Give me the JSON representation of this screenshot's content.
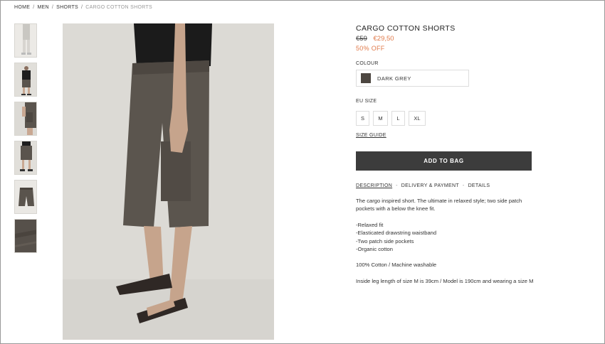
{
  "breadcrumb": [
    "HOME",
    "MEN",
    "SHORTS",
    "CARGO COTTON SHORTS"
  ],
  "breadcrumb_separator": "/",
  "product": {
    "title": "CARGO COTTON SHORTS",
    "old_price": "€59",
    "new_price": "€29,50",
    "discount": "50% OFF",
    "colour_label": "COLOUR",
    "colour_name": "DARK GREY",
    "colour_hex": "#4c4640",
    "size_label": "EU SIZE",
    "sizes": [
      "S",
      "M",
      "L",
      "XL"
    ],
    "size_guide": "SIZE GUIDE",
    "add_to_bag": "ADD TO BAG"
  },
  "tabs": [
    "DESCRIPTION",
    "DELIVERY & PAYMENT",
    "DETAILS"
  ],
  "tab_separator": "-",
  "description": {
    "intro": "The cargo inspired short. The ultimate in relaxed style; two side patch pockets with a below the knee fit.",
    "features": [
      "-Relaxed fit",
      "-Elasticated drawstring waistband",
      "-Two patch side pockets",
      "-Organic cotton"
    ],
    "care": "100% Cotton / Machine washable",
    "fit_note": "Inside leg length of size M is 39cm / Model is 190cm and wearing a size M"
  },
  "colors": {
    "accent": "#e07a4a",
    "button": "#3c3c3c"
  }
}
